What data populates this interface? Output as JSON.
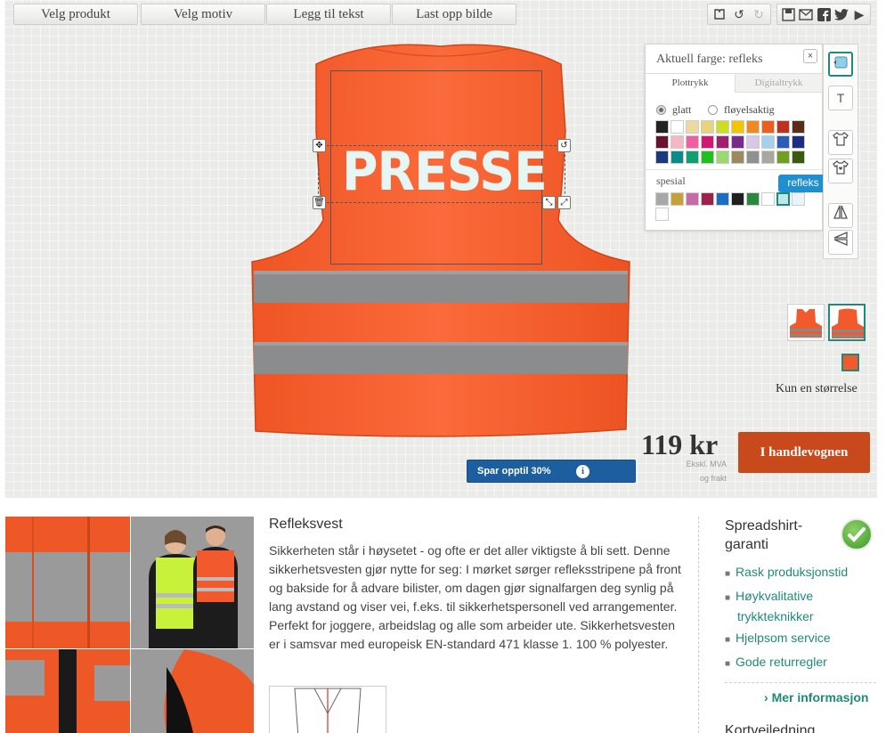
{
  "toolbar": {
    "buttons": [
      "Velg produkt",
      "Velg motiv",
      "Legg til tekst",
      "Last opp bilde"
    ]
  },
  "design": {
    "text": "PRESSE",
    "text_color": "#e5f6f5",
    "product_color": "#f25a2e"
  },
  "color_panel": {
    "title": "Aktuell farge: refleks",
    "close": "×",
    "tabs": [
      "Plottrykk",
      "Digitaltrykk"
    ],
    "options": [
      "glatt",
      "fløyelsaktig"
    ],
    "selected_option": "glatt",
    "special_label": "spesial",
    "tooltip": "refleks",
    "colors": [
      "#222222",
      "#ffffff",
      "#f0d9a0",
      "#e8d27a",
      "#ccdd22",
      "#f4c400",
      "#f08a20",
      "#e8601c",
      "#c03020",
      "#5a2c1c",
      "#6c1030",
      "#f4b8c4",
      "#f060a0",
      "#d01870",
      "#a02070",
      "#7a2a8a",
      "#d8c8e8",
      "#a8d0ec",
      "#2a5cb8",
      "#1c2c80",
      "#1a3a7c",
      "#0a8a8a",
      "#10a070",
      "#20c020",
      "#9cd870",
      "#9a8a60",
      "#90908c",
      "#a8a8a0",
      "#70a020",
      "#3a5a10"
    ],
    "special_colors": [
      "#a8a8a8",
      "#c8a038",
      "#c86aa8",
      "#a0204c",
      "#1a70c0",
      "#202020",
      "#2a8a3c",
      "#ffffff",
      "#bde8ea",
      "#e8f4f8",
      "#ffffff"
    ]
  },
  "side_tools": [
    "color-tool-icon",
    "text-tool-icon",
    "shirt-front-icon",
    "shirt-heart-icon",
    "flip-vertical-icon",
    "flip-horizontal-icon"
  ],
  "size": {
    "text": "Kun en størrelse"
  },
  "price": {
    "amount": "119 kr",
    "note1": "Ekskl. MVA",
    "note2": "og frakt"
  },
  "cart_button": "I handlevognen",
  "save_bar": {
    "text": "Spar opptil 30%",
    "info": "i"
  },
  "product": {
    "title": "Refleksvest",
    "description": "Sikkerheten står i høysetet - og ofte er det aller viktigste å bli sett. Denne sikkerhetsvesten gjør nytte for seg: I mørket sørger refleksstripene på front og bakside for å advare bilister, om dagen gjør signalfargen deg synlig på lang avstand og viser vei, f.eks. til sikkerhetspersonell ved arrangementer. Perfekt for joggere, arbeidslag og alle som arbeider ute. Sikkerhetsvesten er i samsvar med europeisk EN-standard 471 klasse 1. 100 % polyester."
  },
  "guarantee": {
    "title": "Spreadshirt-garanti",
    "items": [
      "Rask produksjonstid",
      "Høykvalitative trykkteknikker",
      "Hjelpsom service",
      "Gode returregler"
    ],
    "more": "Mer informasjon",
    "size_guide": "Kortveiledning"
  }
}
